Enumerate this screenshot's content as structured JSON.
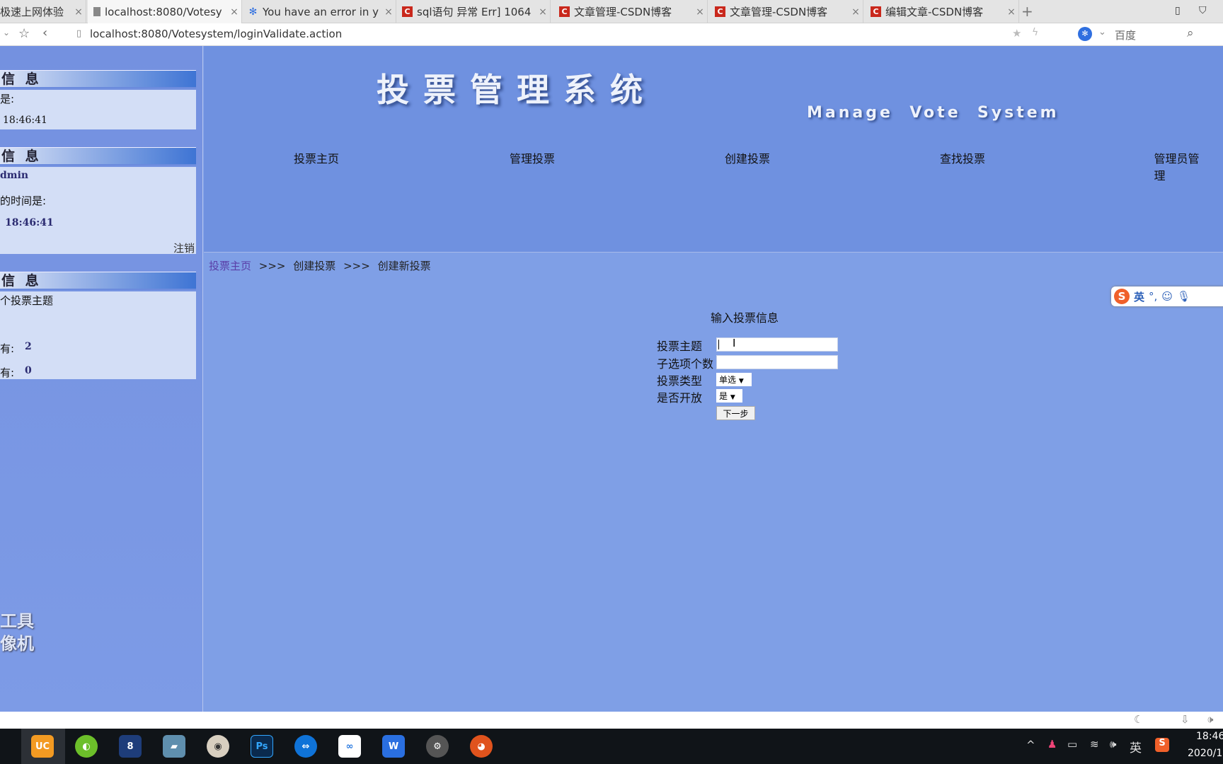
{
  "browser": {
    "tabs": [
      {
        "title": "极速上网体验",
        "icon": "page-icon"
      },
      {
        "title": "localhost:8080/Votesy",
        "icon": "page-icon",
        "active": true
      },
      {
        "title": "You have an error in y",
        "icon": "baidu-paw-icon"
      },
      {
        "title": "sql语句 异常 Err] 1064",
        "icon": "csdn-icon"
      },
      {
        "title": "文章管理-CSDN博客",
        "icon": "csdn-icon"
      },
      {
        "title": "文章管理-CSDN博客",
        "icon": "csdn-icon"
      },
      {
        "title": "编辑文章-CSDN博客",
        "icon": "csdn-icon"
      }
    ],
    "new_tab": "+",
    "url": "localhost:8080/Votesystem/loginValidate.action",
    "search_engine": "百度",
    "csdn_color": "#c9281c"
  },
  "sidebar": {
    "panel1": {
      "title": "信 息",
      "line1": "是:",
      "time": "18:46:41"
    },
    "panel2": {
      "title": "信 息",
      "user": "dmin",
      "line2": "的时间是:",
      "time": "18:46:41",
      "logout": "注销"
    },
    "panel3": {
      "title": "信 息",
      "line1": "个投票主题",
      "row1_label": "有:",
      "row1_value": "2",
      "row2_label": "有:",
      "row2_value": "0"
    },
    "watermark": [
      "工具",
      "像机"
    ]
  },
  "header": {
    "title": "投票管理系统",
    "subtitle": "Manage  Vote  System",
    "nav": [
      "投票主页",
      "管理投票",
      "创建投票",
      "查找投票",
      "管理员管理"
    ]
  },
  "breadcrumb": {
    "home": "投票主页",
    "sep": ">>>",
    "level2": "创建投票",
    "level3": "创建新投票"
  },
  "form": {
    "title": "输入投票信息",
    "fields": [
      {
        "label": "投票主题",
        "value": ""
      },
      {
        "label": "子选项个数",
        "value": ""
      },
      {
        "label": "投票类型",
        "selected": "单选"
      },
      {
        "label": "是否开放",
        "selected": "是"
      }
    ],
    "submit": "下一步"
  },
  "ime": {
    "mode": "英"
  },
  "taskbar": {
    "tray_ime": "英",
    "time": "18:46",
    "date": "2020/1"
  }
}
